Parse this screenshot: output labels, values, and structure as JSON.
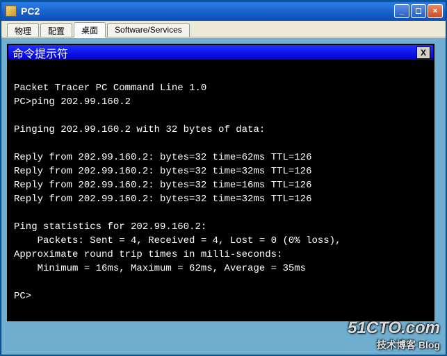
{
  "window": {
    "title": "PC2",
    "min_label": "_",
    "close_label": "×"
  },
  "tabs": [
    {
      "label": "物理"
    },
    {
      "label": "配置"
    },
    {
      "label": "桌面"
    },
    {
      "label": "Software/Services"
    }
  ],
  "terminal": {
    "title": "命令提示符",
    "close_label": "X",
    "lines": [
      "",
      "Packet Tracer PC Command Line 1.0",
      "PC>ping 202.99.160.2",
      "",
      "Pinging 202.99.160.2 with 32 bytes of data:",
      "",
      "Reply from 202.99.160.2: bytes=32 time=62ms TTL=126",
      "Reply from 202.99.160.2: bytes=32 time=32ms TTL=126",
      "Reply from 202.99.160.2: bytes=32 time=16ms TTL=126",
      "Reply from 202.99.160.2: bytes=32 time=32ms TTL=126",
      "",
      "Ping statistics for 202.99.160.2:",
      "    Packets: Sent = 4, Received = 4, Lost = 0 (0% loss),",
      "Approximate round trip times in milli-seconds:",
      "    Minimum = 16ms, Maximum = 62ms, Average = 35ms",
      "",
      "PC>"
    ]
  },
  "watermark": {
    "big": "51CTO.com",
    "small": "技术博客   Blog"
  }
}
